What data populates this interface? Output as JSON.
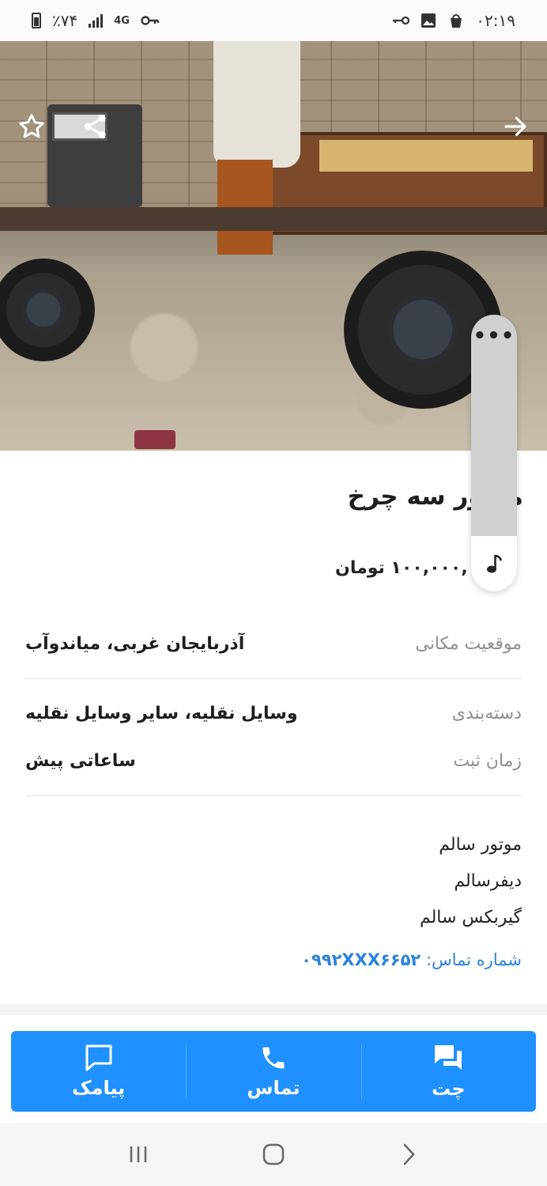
{
  "status_bar": {
    "time": "۰۲:۱۹",
    "battery": "٪۷۴",
    "network": "4G"
  },
  "listing": {
    "title": "موتور سه چرخ",
    "price": "۱۰۰,۰۰۰,۰۰۰ تومان",
    "image_count": 2,
    "active_image": 1,
    "details": {
      "location_label": "موقعیت مکانی",
      "location_value": "آذربایجان غربی، میاندوآب",
      "category_label": "دسته‌بندی",
      "category_value": "وسایل نقلیه، سایر وسایل نقلیه",
      "time_label": "زمان ثبت",
      "time_value": "ساعاتی پیش"
    },
    "description": [
      "موتور سالم",
      "دیفرسالم",
      "گیربکس سالم"
    ],
    "contact_label": "شماره تماس:",
    "contact_number": "۰۹۹۲XXX۶۶۵۲"
  },
  "float_widget": {
    "more_label": "•••",
    "music_icon": "music-note-icon"
  },
  "actions": {
    "chat_label": "چت",
    "call_label": "تماس",
    "sms_label": "پیامک"
  },
  "colors": {
    "accent": "#1e90ff",
    "link": "#2b82df"
  }
}
